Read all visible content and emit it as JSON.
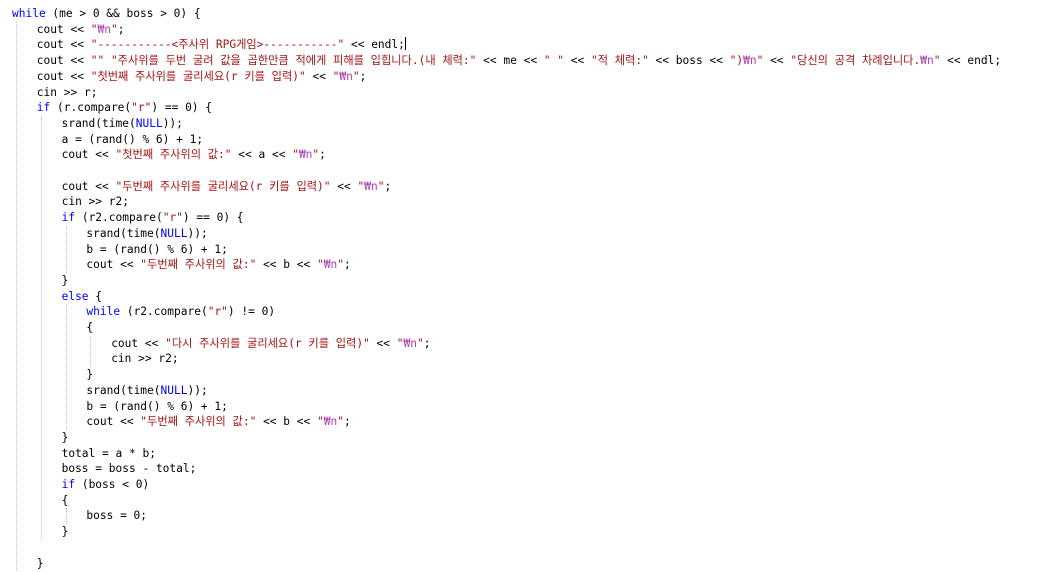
{
  "editor": {
    "language": "C++",
    "colors": {
      "keyword": "#0000ff",
      "identifier": "#000000",
      "string": "#a31515",
      "escape": "#b040b0",
      "guide": "#c4c4c4",
      "background": "#ffffff"
    },
    "lines": [
      {
        "indent": 0,
        "tokens": [
          {
            "t": "while",
            "c": "kw"
          },
          {
            "t": " (me > 0 && boss > 0) {",
            "c": "p"
          }
        ]
      },
      {
        "indent": 1,
        "tokens": [
          {
            "t": "cout",
            "c": "id"
          },
          {
            "t": " << ",
            "c": "op"
          },
          {
            "t": "\"",
            "c": "str"
          },
          {
            "t": "₩n",
            "c": "esc"
          },
          {
            "t": "\"",
            "c": "str"
          },
          {
            "t": ";",
            "c": "p"
          }
        ]
      },
      {
        "indent": 1,
        "caret_at_end": true,
        "tokens": [
          {
            "t": "cout",
            "c": "id"
          },
          {
            "t": " << ",
            "c": "op"
          },
          {
            "t": "\"-----------<주사위 RPG게임>-----------\"",
            "c": "str"
          },
          {
            "t": " << ",
            "c": "op"
          },
          {
            "t": "endl",
            "c": "id"
          },
          {
            "t": ";",
            "c": "p"
          }
        ]
      },
      {
        "indent": 1,
        "tokens": [
          {
            "t": "cout",
            "c": "id"
          },
          {
            "t": " << ",
            "c": "op"
          },
          {
            "t": "\"\"",
            "c": "str"
          },
          {
            "t": " ",
            "c": "p"
          },
          {
            "t": "\"주사위를 두번 굴려 값을 곱한만큼 적에게 피해를 입힙니다.(내 체력:\"",
            "c": "str"
          },
          {
            "t": " << ",
            "c": "op"
          },
          {
            "t": "me",
            "c": "id"
          },
          {
            "t": " << ",
            "c": "op"
          },
          {
            "t": "\" \"",
            "c": "str"
          },
          {
            "t": " << ",
            "c": "op"
          },
          {
            "t": "\"적 체력:\"",
            "c": "str"
          },
          {
            "t": " << ",
            "c": "op"
          },
          {
            "t": "boss",
            "c": "id"
          },
          {
            "t": " << ",
            "c": "op"
          },
          {
            "t": "\")",
            "c": "str"
          },
          {
            "t": "₩n",
            "c": "esc"
          },
          {
            "t": "\"",
            "c": "str"
          },
          {
            "t": " << ",
            "c": "op"
          },
          {
            "t": "\"당신의 공격 차례입니다.",
            "c": "str"
          },
          {
            "t": "₩n",
            "c": "esc"
          },
          {
            "t": "\"",
            "c": "str"
          },
          {
            "t": " << ",
            "c": "op"
          },
          {
            "t": "endl",
            "c": "id"
          },
          {
            "t": ";",
            "c": "p"
          }
        ]
      },
      {
        "indent": 1,
        "tokens": [
          {
            "t": "cout",
            "c": "id"
          },
          {
            "t": " << ",
            "c": "op"
          },
          {
            "t": "\"첫번째 주사위를 굴리세요(r 키를 입력)\"",
            "c": "str"
          },
          {
            "t": " << ",
            "c": "op"
          },
          {
            "t": "\"",
            "c": "str"
          },
          {
            "t": "₩n",
            "c": "esc"
          },
          {
            "t": "\"",
            "c": "str"
          },
          {
            "t": ";",
            "c": "p"
          }
        ]
      },
      {
        "indent": 1,
        "tokens": [
          {
            "t": "cin",
            "c": "id"
          },
          {
            "t": " >> ",
            "c": "op"
          },
          {
            "t": "r",
            "c": "id"
          },
          {
            "t": ";",
            "c": "p"
          }
        ]
      },
      {
        "indent": 1,
        "tokens": [
          {
            "t": "if",
            "c": "kw"
          },
          {
            "t": " (",
            "c": "p"
          },
          {
            "t": "r",
            "c": "id"
          },
          {
            "t": ".",
            "c": "p"
          },
          {
            "t": "compare",
            "c": "fn"
          },
          {
            "t": "(",
            "c": "p"
          },
          {
            "t": "\"r\"",
            "c": "str"
          },
          {
            "t": ") == 0) {",
            "c": "p"
          }
        ]
      },
      {
        "indent": 2,
        "tokens": [
          {
            "t": "srand",
            "c": "fn"
          },
          {
            "t": "(",
            "c": "p"
          },
          {
            "t": "time",
            "c": "fn"
          },
          {
            "t": "(",
            "c": "p"
          },
          {
            "t": "NULL",
            "c": "kw"
          },
          {
            "t": "));",
            "c": "p"
          }
        ]
      },
      {
        "indent": 2,
        "tokens": [
          {
            "t": "a",
            "c": "id"
          },
          {
            "t": " = (",
            "c": "p"
          },
          {
            "t": "rand",
            "c": "fn"
          },
          {
            "t": "() % 6) + 1;",
            "c": "p"
          }
        ]
      },
      {
        "indent": 2,
        "tokens": [
          {
            "t": "cout",
            "c": "id"
          },
          {
            "t": " << ",
            "c": "op"
          },
          {
            "t": "\"첫번째 주사위의 값:\"",
            "c": "str"
          },
          {
            "t": " << ",
            "c": "op"
          },
          {
            "t": "a",
            "c": "id"
          },
          {
            "t": " << ",
            "c": "op"
          },
          {
            "t": "\"",
            "c": "str"
          },
          {
            "t": "₩n",
            "c": "esc"
          },
          {
            "t": "\"",
            "c": "str"
          },
          {
            "t": ";",
            "c": "p"
          }
        ]
      },
      {
        "indent": 2,
        "tokens": []
      },
      {
        "indent": 2,
        "tokens": [
          {
            "t": "cout",
            "c": "id"
          },
          {
            "t": " << ",
            "c": "op"
          },
          {
            "t": "\"두번째 주사위를 굴리세요(r 키를 입력)\"",
            "c": "str"
          },
          {
            "t": " << ",
            "c": "op"
          },
          {
            "t": "\"",
            "c": "str"
          },
          {
            "t": "₩n",
            "c": "esc"
          },
          {
            "t": "\"",
            "c": "str"
          },
          {
            "t": ";",
            "c": "p"
          }
        ]
      },
      {
        "indent": 2,
        "tokens": [
          {
            "t": "cin",
            "c": "id"
          },
          {
            "t": " >> ",
            "c": "op"
          },
          {
            "t": "r2",
            "c": "id"
          },
          {
            "t": ";",
            "c": "p"
          }
        ]
      },
      {
        "indent": 2,
        "tokens": [
          {
            "t": "if",
            "c": "kw"
          },
          {
            "t": " (",
            "c": "p"
          },
          {
            "t": "r2",
            "c": "id"
          },
          {
            "t": ".",
            "c": "p"
          },
          {
            "t": "compare",
            "c": "fn"
          },
          {
            "t": "(",
            "c": "p"
          },
          {
            "t": "\"r\"",
            "c": "str"
          },
          {
            "t": ") == 0) {",
            "c": "p"
          }
        ]
      },
      {
        "indent": 3,
        "tokens": [
          {
            "t": "srand",
            "c": "fn"
          },
          {
            "t": "(",
            "c": "p"
          },
          {
            "t": "time",
            "c": "fn"
          },
          {
            "t": "(",
            "c": "p"
          },
          {
            "t": "NULL",
            "c": "kw"
          },
          {
            "t": "));",
            "c": "p"
          }
        ]
      },
      {
        "indent": 3,
        "tokens": [
          {
            "t": "b",
            "c": "id"
          },
          {
            "t": " = (",
            "c": "p"
          },
          {
            "t": "rand",
            "c": "fn"
          },
          {
            "t": "() % 6) + 1;",
            "c": "p"
          }
        ]
      },
      {
        "indent": 3,
        "tokens": [
          {
            "t": "cout",
            "c": "id"
          },
          {
            "t": " << ",
            "c": "op"
          },
          {
            "t": "\"두번째 주사위의 값:\"",
            "c": "str"
          },
          {
            "t": " << ",
            "c": "op"
          },
          {
            "t": "b",
            "c": "id"
          },
          {
            "t": " << ",
            "c": "op"
          },
          {
            "t": "\"",
            "c": "str"
          },
          {
            "t": "₩n",
            "c": "esc"
          },
          {
            "t": "\"",
            "c": "str"
          },
          {
            "t": ";",
            "c": "p"
          }
        ]
      },
      {
        "indent": 2,
        "tokens": [
          {
            "t": "}",
            "c": "p"
          }
        ]
      },
      {
        "indent": 2,
        "tokens": [
          {
            "t": "else",
            "c": "kw"
          },
          {
            "t": " {",
            "c": "p"
          }
        ]
      },
      {
        "indent": 3,
        "tokens": [
          {
            "t": "while",
            "c": "kw"
          },
          {
            "t": " (",
            "c": "p"
          },
          {
            "t": "r2",
            "c": "id"
          },
          {
            "t": ".",
            "c": "p"
          },
          {
            "t": "compare",
            "c": "fn"
          },
          {
            "t": "(",
            "c": "p"
          },
          {
            "t": "\"r\"",
            "c": "str"
          },
          {
            "t": ") != 0)",
            "c": "p"
          }
        ]
      },
      {
        "indent": 3,
        "tokens": [
          {
            "t": "{",
            "c": "p"
          }
        ]
      },
      {
        "indent": 4,
        "tokens": [
          {
            "t": "cout",
            "c": "id"
          },
          {
            "t": " << ",
            "c": "op"
          },
          {
            "t": "\"다시 주사위를 굴리세요(r 키를 입력)\"",
            "c": "str"
          },
          {
            "t": " << ",
            "c": "op"
          },
          {
            "t": "\"",
            "c": "str"
          },
          {
            "t": "₩n",
            "c": "esc"
          },
          {
            "t": "\"",
            "c": "str"
          },
          {
            "t": ";",
            "c": "p"
          }
        ]
      },
      {
        "indent": 4,
        "tokens": [
          {
            "t": "cin",
            "c": "id"
          },
          {
            "t": " >> ",
            "c": "op"
          },
          {
            "t": "r2",
            "c": "id"
          },
          {
            "t": ";",
            "c": "p"
          }
        ]
      },
      {
        "indent": 3,
        "tokens": [
          {
            "t": "}",
            "c": "p"
          }
        ]
      },
      {
        "indent": 3,
        "tokens": [
          {
            "t": "srand",
            "c": "fn"
          },
          {
            "t": "(",
            "c": "p"
          },
          {
            "t": "time",
            "c": "fn"
          },
          {
            "t": "(",
            "c": "p"
          },
          {
            "t": "NULL",
            "c": "kw"
          },
          {
            "t": "));",
            "c": "p"
          }
        ]
      },
      {
        "indent": 3,
        "tokens": [
          {
            "t": "b",
            "c": "id"
          },
          {
            "t": " = (",
            "c": "p"
          },
          {
            "t": "rand",
            "c": "fn"
          },
          {
            "t": "() % 6) + 1;",
            "c": "p"
          }
        ]
      },
      {
        "indent": 3,
        "tokens": [
          {
            "t": "cout",
            "c": "id"
          },
          {
            "t": " << ",
            "c": "op"
          },
          {
            "t": "\"두번째 주사위의 값:\"",
            "c": "str"
          },
          {
            "t": " << ",
            "c": "op"
          },
          {
            "t": "b",
            "c": "id"
          },
          {
            "t": " << ",
            "c": "op"
          },
          {
            "t": "\"",
            "c": "str"
          },
          {
            "t": "₩n",
            "c": "esc"
          },
          {
            "t": "\"",
            "c": "str"
          },
          {
            "t": ";",
            "c": "p"
          }
        ]
      },
      {
        "indent": 2,
        "tokens": [
          {
            "t": "}",
            "c": "p"
          }
        ]
      },
      {
        "indent": 2,
        "tokens": [
          {
            "t": "total",
            "c": "id"
          },
          {
            "t": " = ",
            "c": "p"
          },
          {
            "t": "a",
            "c": "id"
          },
          {
            "t": " * ",
            "c": "p"
          },
          {
            "t": "b",
            "c": "id"
          },
          {
            "t": ";",
            "c": "p"
          }
        ]
      },
      {
        "indent": 2,
        "tokens": [
          {
            "t": "boss",
            "c": "id"
          },
          {
            "t": " = ",
            "c": "p"
          },
          {
            "t": "boss",
            "c": "id"
          },
          {
            "t": " - ",
            "c": "p"
          },
          {
            "t": "total",
            "c": "id"
          },
          {
            "t": ";",
            "c": "p"
          }
        ]
      },
      {
        "indent": 2,
        "tokens": [
          {
            "t": "if",
            "c": "kw"
          },
          {
            "t": " (",
            "c": "p"
          },
          {
            "t": "boss",
            "c": "id"
          },
          {
            "t": " < 0)",
            "c": "p"
          }
        ]
      },
      {
        "indent": 2,
        "tokens": [
          {
            "t": "{",
            "c": "p"
          }
        ]
      },
      {
        "indent": 3,
        "tokens": [
          {
            "t": "boss",
            "c": "id"
          },
          {
            "t": " = 0;",
            "c": "p"
          }
        ]
      },
      {
        "indent": 2,
        "tokens": [
          {
            "t": "}",
            "c": "p"
          }
        ]
      },
      {
        "indent": 1,
        "tokens": []
      },
      {
        "indent": 1,
        "tokens": [
          {
            "t": "}",
            "c": "p"
          }
        ]
      }
    ]
  }
}
